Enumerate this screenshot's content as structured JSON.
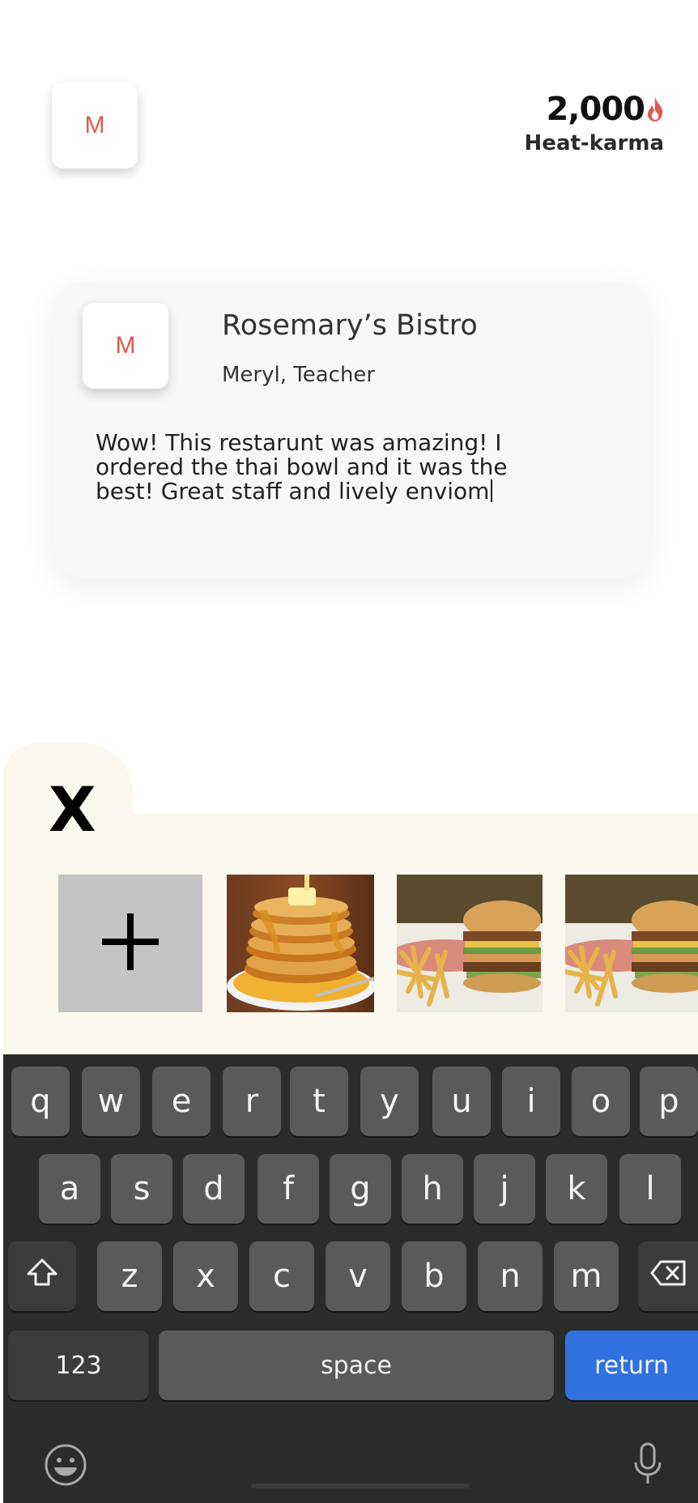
{
  "header": {
    "avatar_letter": "M",
    "karma_value": "2,000",
    "karma_label": "Heat-karma",
    "flame_icon": "flame-icon",
    "accent_color": "#e05a52"
  },
  "review": {
    "avatar_letter": "M",
    "restaurant": "Rosemary’s Bistro",
    "author": "Meryl, Teacher",
    "text": "Wow! This restarunt was amazing! I ordered the thai bowl and it was the best! Great staff and lively enviom"
  },
  "photos": {
    "close_label": "X",
    "add_icon": "plus-icon",
    "items": [
      {
        "name": "pancakes-photo"
      },
      {
        "name": "burger-fries-photo"
      },
      {
        "name": "burger-fries-photo"
      }
    ],
    "panel_color": "#fbf8ef"
  },
  "keyboard": {
    "row1": [
      "q",
      "w",
      "e",
      "r",
      "t",
      "y",
      "u",
      "i",
      "o",
      "p"
    ],
    "row2": [
      "a",
      "s",
      "d",
      "f",
      "g",
      "h",
      "j",
      "k",
      "l"
    ],
    "row3": [
      "z",
      "x",
      "c",
      "v",
      "b",
      "n",
      "m"
    ],
    "shift_icon": "shift-icon",
    "backspace_icon": "backspace-icon",
    "numbers_label": "123",
    "space_label": "space",
    "return_label": "return",
    "emoji_icon": "emoji-icon",
    "mic_icon": "microphone-icon",
    "return_color": "#2f72e0"
  }
}
